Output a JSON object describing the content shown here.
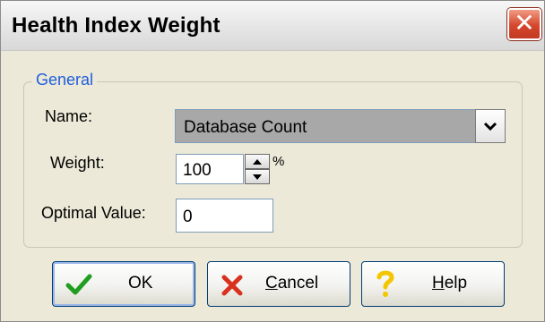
{
  "window": {
    "title": "Health Index Weight",
    "close_glyph": "✕"
  },
  "group": {
    "legend": "General"
  },
  "fields": {
    "name_label": "Name:",
    "name_value": "Database Count",
    "weight_label": "Weight:",
    "weight_value": "100",
    "weight_unit": "%",
    "optimal_label": "Optimal Value:",
    "optimal_value": "0"
  },
  "buttons": {
    "ok": {
      "label": "OK",
      "icon": "checkmark-icon"
    },
    "cancel": {
      "label_mnemonic": "C",
      "label_rest": "ancel",
      "icon": "x-cancel-icon"
    },
    "help": {
      "label_mnemonic": "H",
      "label_rest": "elp",
      "icon": "question-icon"
    }
  },
  "colors": {
    "legend": "#1f5edb",
    "close_red": "#d5472d",
    "ok_green": "#1f9e1f",
    "cancel_red": "#d8321e",
    "help_yellow": "#f3c600",
    "combo_selected_bg": "#a9a8a8"
  }
}
